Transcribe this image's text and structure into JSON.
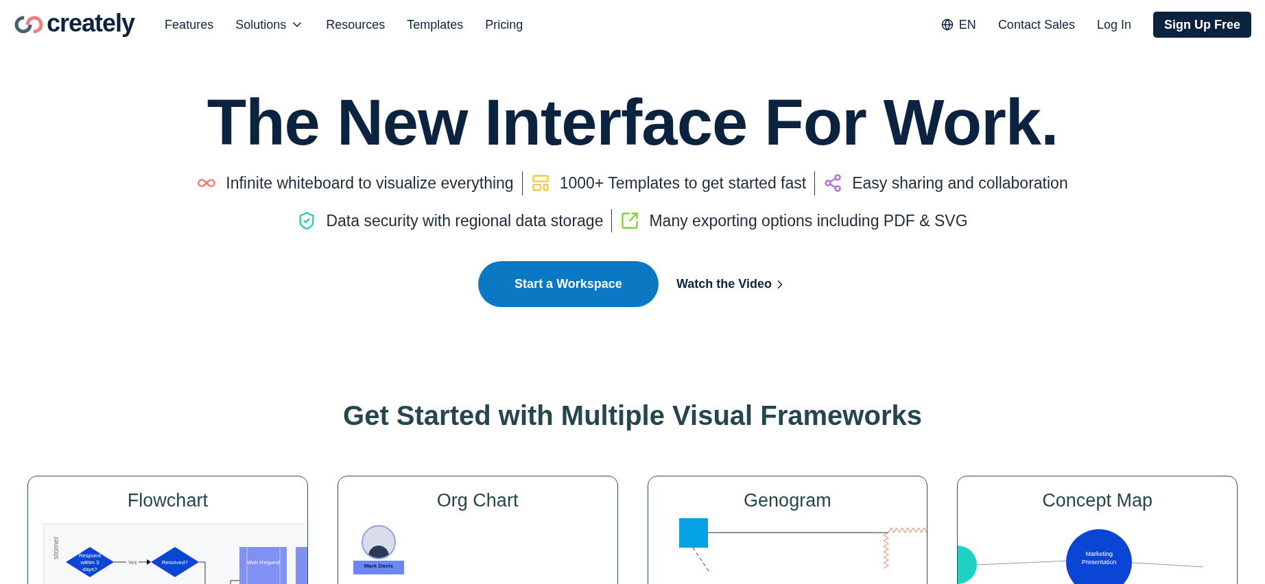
{
  "header": {
    "logo": "creately",
    "nav": [
      {
        "label": "Features",
        "kind": "link"
      },
      {
        "label": "Solutions",
        "kind": "dropdown"
      },
      {
        "label": "Resources",
        "kind": "link"
      },
      {
        "label": "Templates",
        "kind": "link"
      },
      {
        "label": "Pricing",
        "kind": "link"
      }
    ],
    "language": "EN",
    "contact": "Contact Sales",
    "login": "Log In",
    "signup": "Sign Up Free"
  },
  "hero": {
    "title": "The New Interface For Work.",
    "feature_rows": [
      [
        {
          "kind": "infinity",
          "color": "#f26d6d",
          "text": "Infinite whiteboard to visualize everything"
        },
        {
          "kind": "templates",
          "color": "#f5c842",
          "text": "1000+ Templates to get started fast"
        },
        {
          "kind": "share",
          "color": "#b36ad6",
          "text": "Easy sharing and collaboration"
        }
      ],
      [
        {
          "kind": "shield",
          "color": "#1fd1b0",
          "text": "Data security with regional data storage"
        },
        {
          "kind": "export",
          "color": "#7ad62a",
          "text": "Many exporting options including PDF & SVG"
        }
      ]
    ],
    "primary_button": "Start a Workspace",
    "secondary_link": "Watch the Video"
  },
  "frameworks": {
    "heading": "Get Started with Multiple Visual Frameworks",
    "cards": [
      {
        "title": "Flowchart",
        "kind": "flowchart",
        "labels": [
          "stomer",
          "Respond within 3 days?",
          "Yes",
          "Resolved?",
          "Web Request"
        ]
      },
      {
        "title": "Org Chart",
        "kind": "orgchart",
        "labels": [
          "Mark Davis"
        ]
      },
      {
        "title": "Genogram",
        "kind": "genogram"
      },
      {
        "title": "Concept Map",
        "kind": "conceptmap",
        "labels": [
          "Marketing Presentation"
        ]
      }
    ]
  }
}
